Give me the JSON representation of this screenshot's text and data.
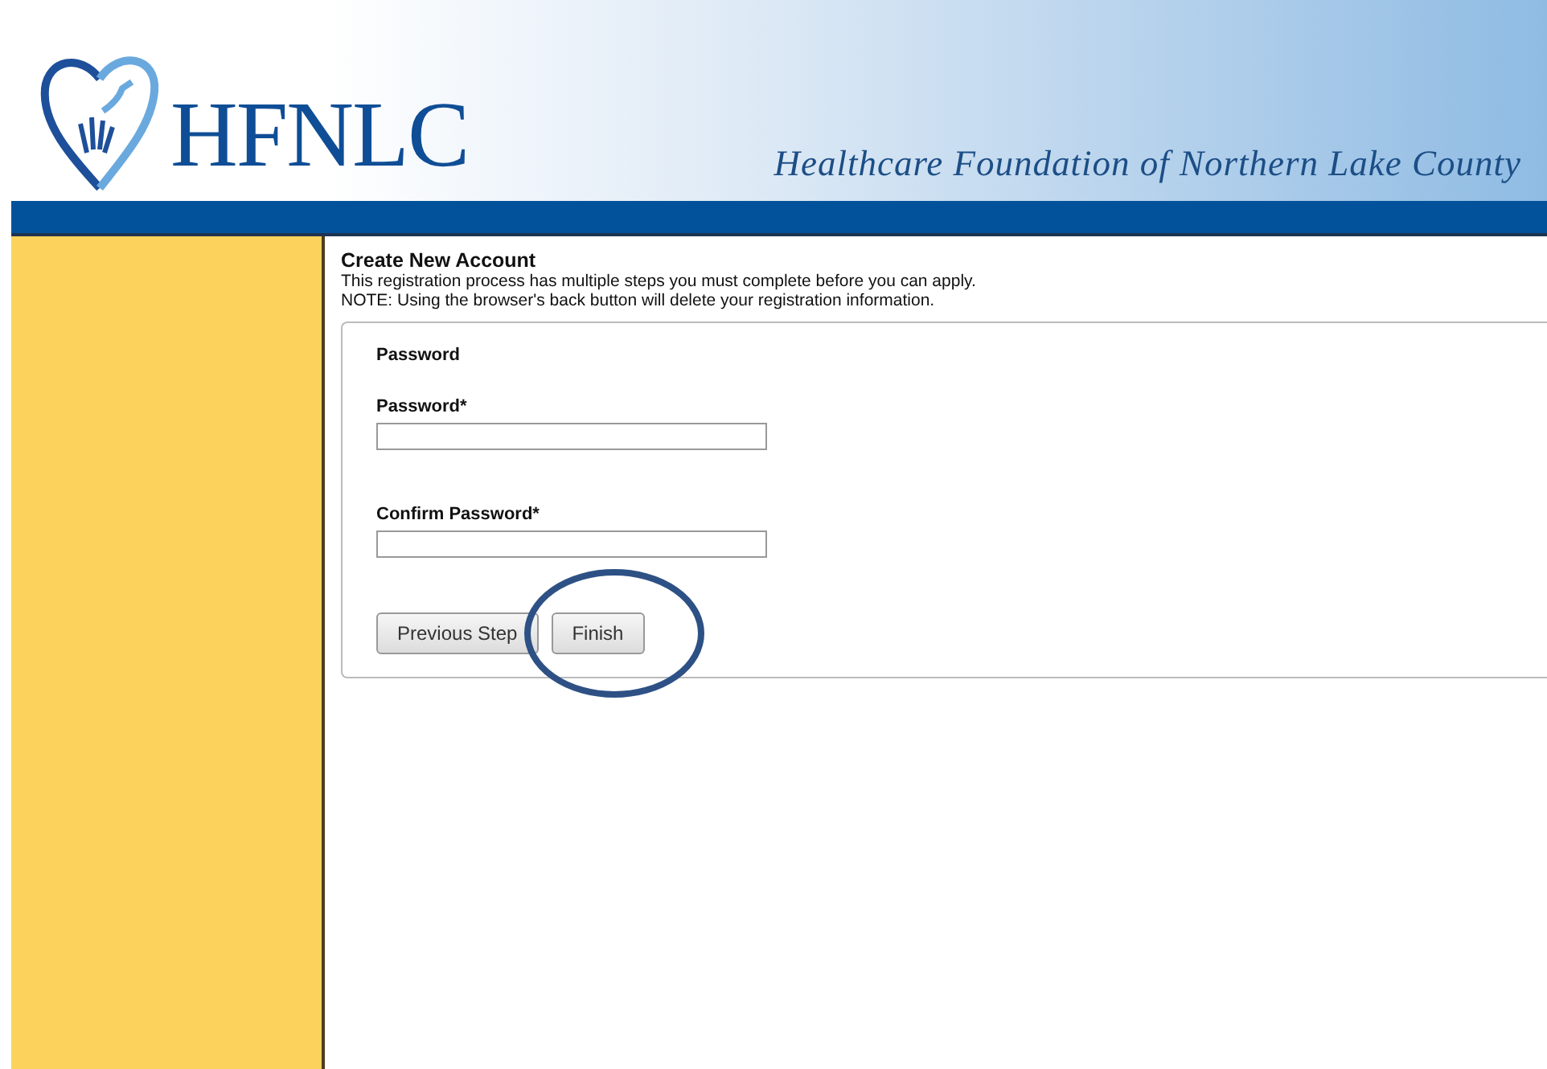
{
  "header": {
    "logo_text": "HFNLC",
    "tagline": "Healthcare Foundation of Northern Lake County"
  },
  "form": {
    "title": "Create New Account",
    "intro": "This registration process has multiple steps you must complete before you can apply.",
    "note": "NOTE: Using the browser's back button will delete your registration information.",
    "section_title": "Password",
    "fields": [
      {
        "label": "Password*"
      },
      {
        "label": "Confirm Password*"
      }
    ],
    "buttons": [
      {
        "label": "Previous Step",
        "highlighted": false
      },
      {
        "label": "Finish",
        "highlighted": true
      }
    ]
  }
}
